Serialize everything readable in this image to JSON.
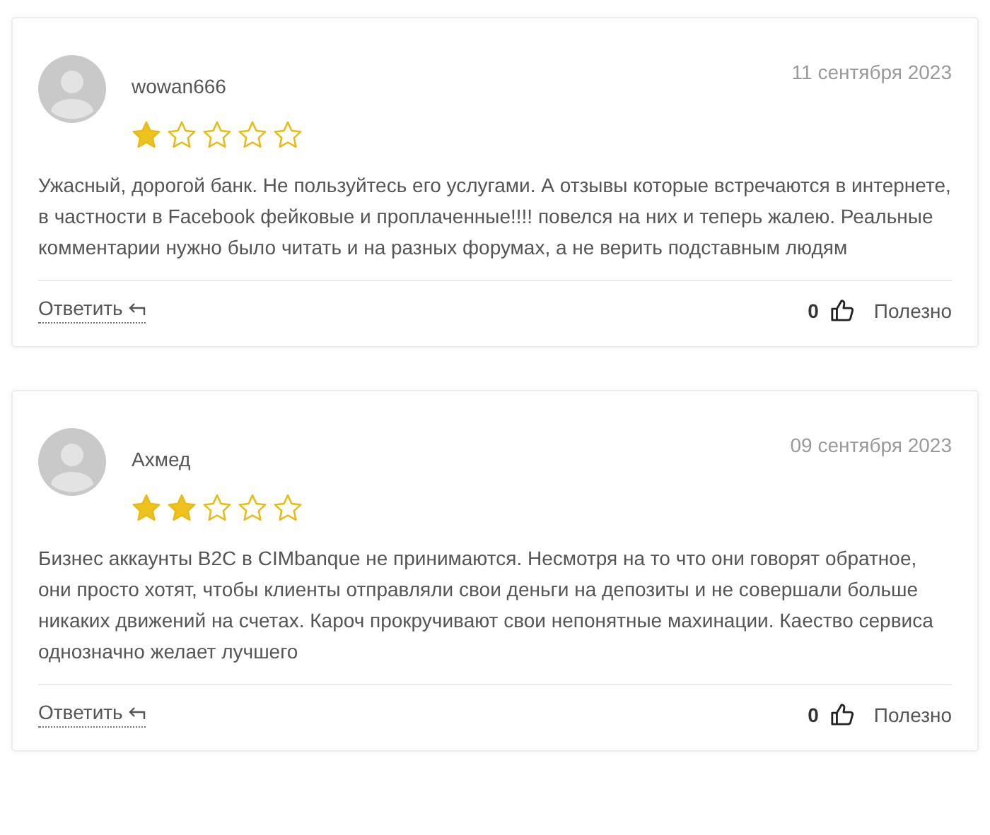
{
  "reviews": [
    {
      "author": "wowan666",
      "date": "11 сентября 2023",
      "stars": 1,
      "text": "Ужасный, дорогой банк. Не пользуйтесь его услугами. А отзывы которые встречаются в интернете, в частности в Facebook фейковые и проплаченные!!!! повелся на них и теперь жалею. Реальные комментарии нужно было читать и на разных форумах, а не верить подставным людям",
      "reply": "Ответить",
      "likes": "0",
      "helpful": "Полезно"
    },
    {
      "author": "Ахмед",
      "date": "09 сентября 2023",
      "stars": 2,
      "text": "Бизнес аккаунты B2C в CIMbanque не принимаются. Несмотря на то что они говорят обратное, они просто хотят, чтобы клиенты отправляли свои деньги на депозиты и не совершали больше никаких движений на счетах. Кароч прокручивают свои непонятные махинации. Каество сервиса однозначно желает лучшего",
      "reply": "Ответить",
      "likes": "0",
      "helpful": "Полезно"
    }
  ]
}
